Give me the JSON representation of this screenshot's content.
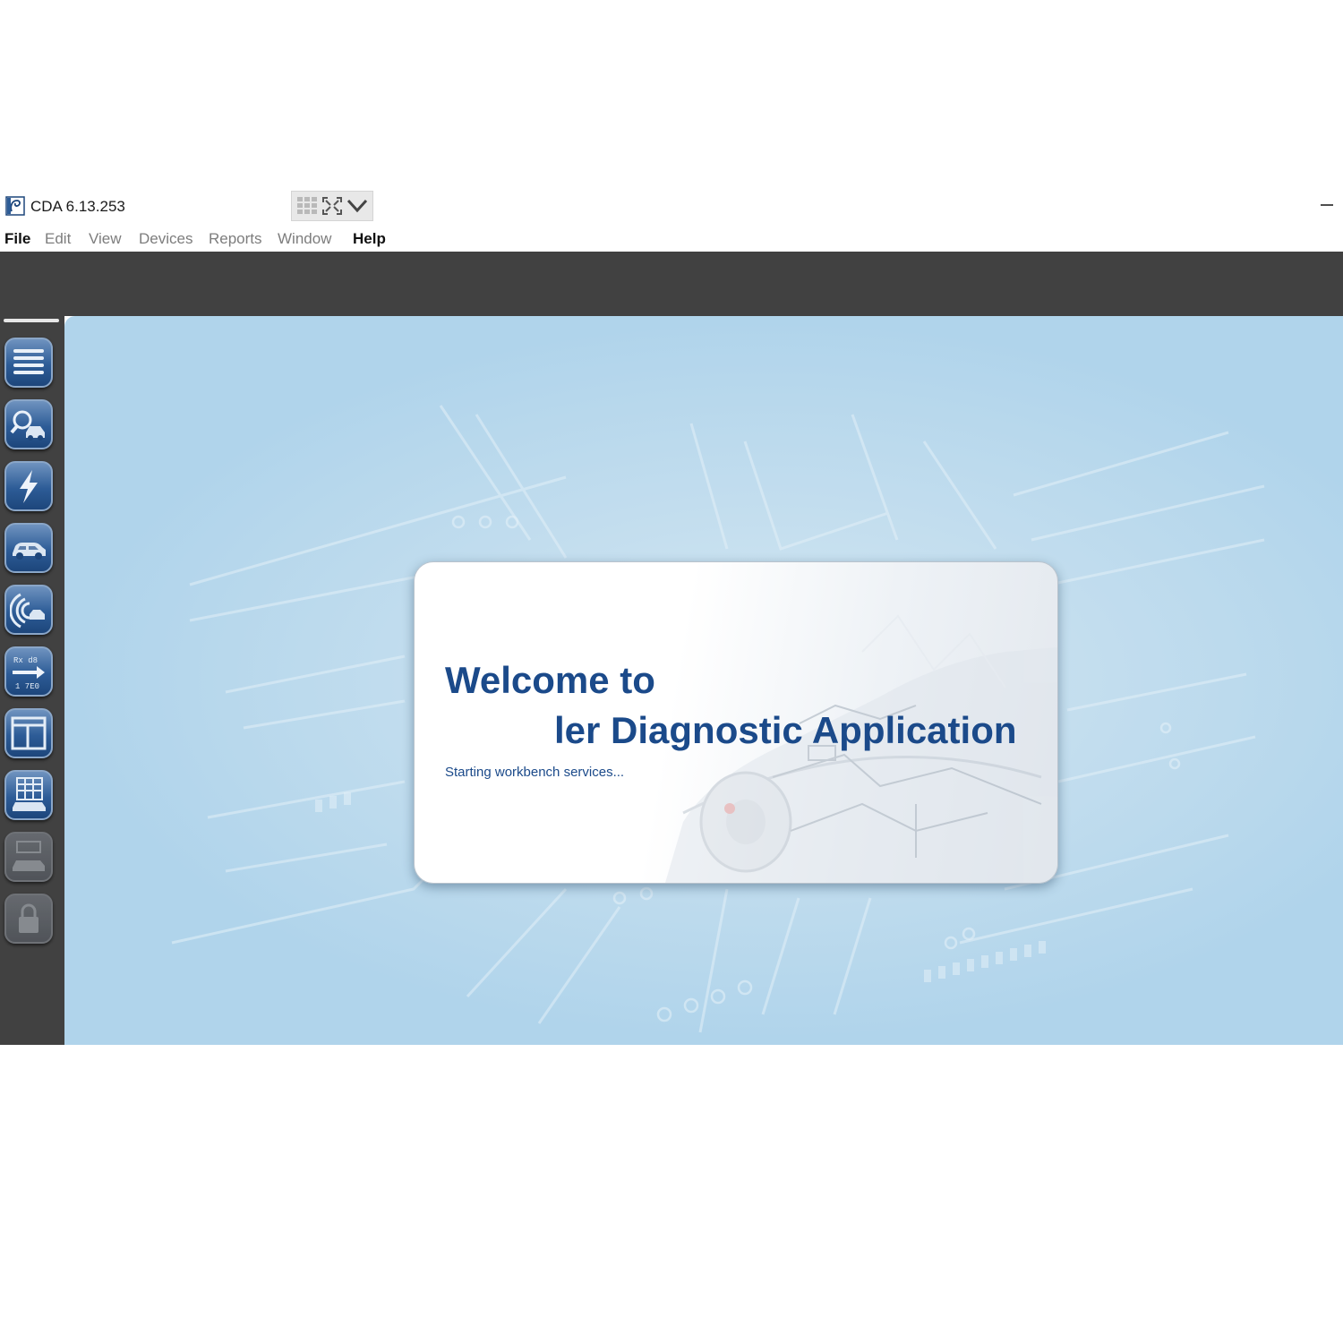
{
  "window": {
    "title": "CDA 6.13.253",
    "minimize_label": "—"
  },
  "menu": {
    "items": [
      {
        "label": "File",
        "enabled": true
      },
      {
        "label": "Edit",
        "enabled": false
      },
      {
        "label": "View",
        "enabled": false
      },
      {
        "label": "Devices",
        "enabled": false
      },
      {
        "label": "Reports",
        "enabled": false
      },
      {
        "label": "Window",
        "enabled": false
      },
      {
        "label": "Help",
        "enabled": true
      }
    ]
  },
  "quick_access": {
    "icons": [
      "grid-icon",
      "fit-screen-icon",
      "chevron-down-icon"
    ]
  },
  "sidebar": {
    "buttons": [
      {
        "icon": "menu-icon",
        "enabled": true
      },
      {
        "icon": "vehicle-search-icon",
        "enabled": true
      },
      {
        "icon": "lightning-icon",
        "enabled": true
      },
      {
        "icon": "car-icon",
        "enabled": true
      },
      {
        "icon": "signal-car-icon",
        "enabled": true
      },
      {
        "icon": "rx-tx-icon",
        "enabled": true,
        "label_top": "Rx d8",
        "label_bottom": "1 7E0"
      },
      {
        "icon": "layout-icon",
        "enabled": true
      },
      {
        "icon": "car-table-icon",
        "enabled": true
      },
      {
        "icon": "car-disabled-icon",
        "enabled": false
      },
      {
        "icon": "lock-icon",
        "enabled": false
      }
    ]
  },
  "splash": {
    "line1": "Welcome to",
    "line2": "ler Diagnostic Application",
    "status": "Starting workbench services..."
  },
  "colors": {
    "accent": "#1b4a8a",
    "dark_chrome": "#414141",
    "workspace_bg": "#b0d4eb"
  }
}
